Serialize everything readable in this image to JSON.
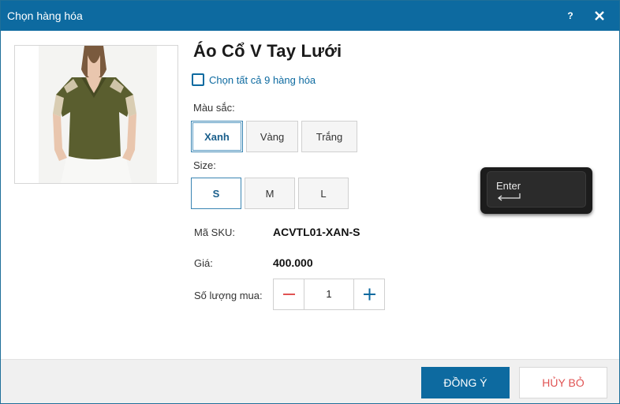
{
  "dialog": {
    "title": "Chọn hàng hóa",
    "help_label": "?"
  },
  "product": {
    "name": "Áo Cổ V Tay Lưới",
    "select_all_label": "Chọn tất cả 9 hàng hóa",
    "select_all_checked": false
  },
  "color": {
    "label": "Màu sắc:",
    "options": [
      "Xanh",
      "Vàng",
      "Trắng"
    ],
    "selected": "Xanh"
  },
  "size": {
    "label": "Size:",
    "options": [
      "S",
      "M",
      "L"
    ],
    "selected": "S"
  },
  "sku": {
    "label": "Mã SKU:",
    "value": "ACVTL01-XAN-S"
  },
  "price": {
    "label": "Giá:",
    "value": "400.000"
  },
  "quantity": {
    "label": "Số lượng mua:",
    "value": "1"
  },
  "footer": {
    "ok_label": "ĐỒNG Ý",
    "cancel_label": "HỦY BỎ"
  },
  "keyboard_hint": {
    "key_label": "Enter"
  },
  "colors": {
    "accent": "#0d6aa0",
    "cancel_text": "#e05353",
    "minus_icon": "#e05353",
    "plus_icon": "#0d6aa0"
  }
}
